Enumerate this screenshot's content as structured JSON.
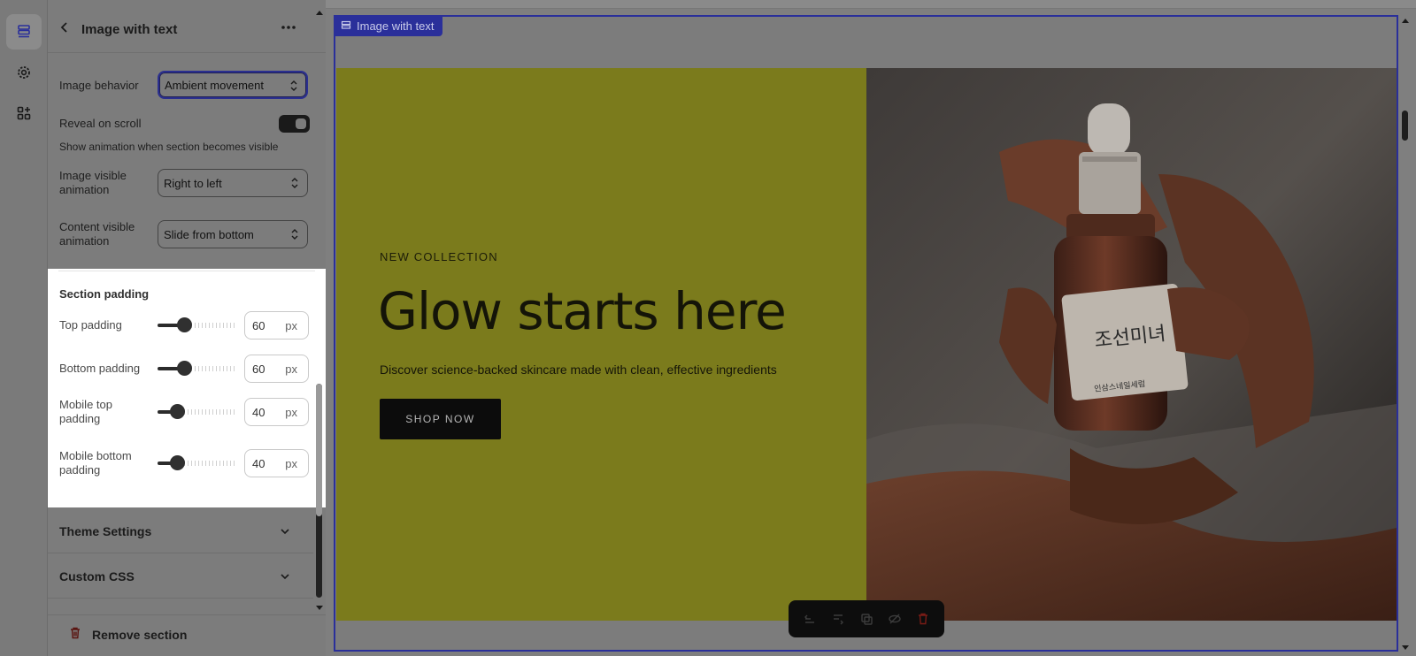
{
  "panel": {
    "title": "Image with text",
    "image_behavior": {
      "label": "Image behavior",
      "value": "Ambient movement"
    },
    "reveal_on_scroll": {
      "label": "Reveal on scroll",
      "enabled": true,
      "help": "Show animation when section becomes visible"
    },
    "image_visible_animation": {
      "label_line1": "Image visible",
      "label_line2": "animation",
      "value": "Right to left"
    },
    "content_visible_animation": {
      "label_line1": "Content visible",
      "label_line2": "animation",
      "value": "Slide from bottom"
    },
    "section_padding": {
      "heading": "Section padding",
      "unit": "px",
      "rows": [
        {
          "label_line1": "Top padding",
          "label_line2": "",
          "value": "60",
          "fraction": 0.33
        },
        {
          "label_line1": "Bottom padding",
          "label_line2": "",
          "value": "60",
          "fraction": 0.33
        },
        {
          "label_line1": "Mobile top",
          "label_line2": "padding",
          "value": "40",
          "fraction": 0.24
        },
        {
          "label_line1": "Mobile bottom",
          "label_line2": "padding",
          "value": "40",
          "fraction": 0.24
        }
      ]
    },
    "theme_settings_label": "Theme Settings",
    "custom_css_label": "Custom CSS",
    "remove_section_label": "Remove section"
  },
  "preview": {
    "section_tag": "Image with text",
    "eyebrow": "NEW COLLECTION",
    "headline": "Glow starts here",
    "subtext": "Discover science-backed skincare made with clean, effective ingredients",
    "button_label": "SHOP NOW",
    "bottle_label_text": "조선미녀",
    "bottle_label_small": "인삼스네일세럼"
  },
  "colors": {
    "accent": "#2a2f9a",
    "content_bg": "#7b7b1c",
    "button_bg": "#0c0c0c",
    "danger": "#b3261e"
  }
}
